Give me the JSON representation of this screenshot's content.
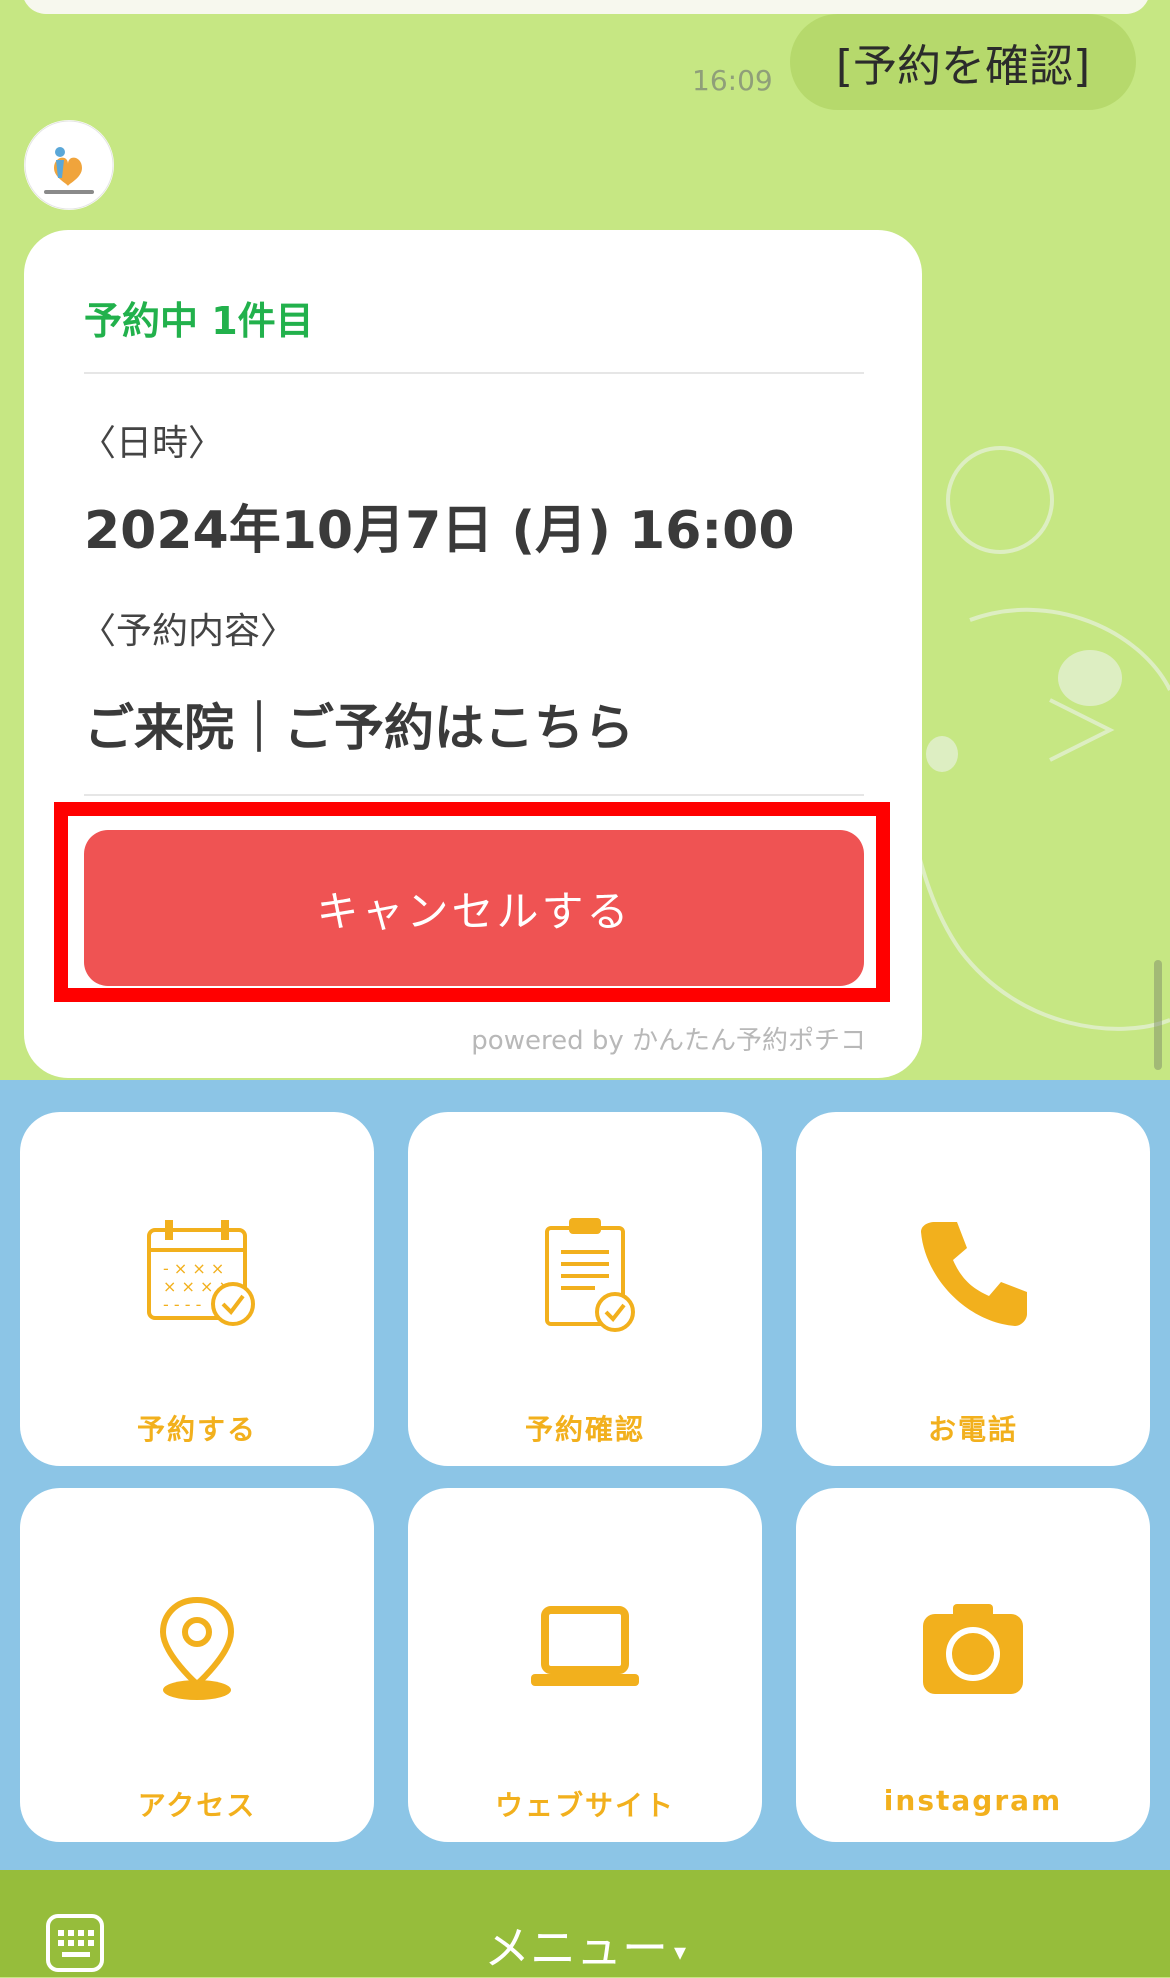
{
  "chat": {
    "user_message": "[予約を確認]",
    "timestamp": "16:09"
  },
  "card": {
    "title": "予約中 1件目",
    "datetime_label": "〈日時〉",
    "datetime_value": "2024年10月7日 (月) 16:00",
    "content_label": "〈予約内容〉",
    "content_value": "ご来院｜ご予約はこちら",
    "cancel_button": "キャンセルする",
    "powered_by": "powered by かんたん予約ポチコ"
  },
  "rich_menu": {
    "items": [
      {
        "label": "予約する",
        "icon": "calendar-check-icon"
      },
      {
        "label": "予約確認",
        "icon": "clipboard-check-icon"
      },
      {
        "label": "お電話",
        "icon": "phone-icon"
      },
      {
        "label": "アクセス",
        "icon": "map-pin-icon"
      },
      {
        "label": "ウェブサイト",
        "icon": "laptop-icon"
      },
      {
        "label": "instagram",
        "icon": "camera-icon"
      }
    ],
    "accent_color": "#f2b01d",
    "background_color": "#8cc5e6"
  },
  "bottom_bar": {
    "menu_label": "メニュー",
    "menu_arrow": "▾"
  },
  "colors": {
    "chat_background": "#c6e783",
    "title_green": "#22b14c",
    "cancel_red": "#ef5353",
    "highlight_red": "#ff0000",
    "bottom_bar": "#96bd3b"
  }
}
